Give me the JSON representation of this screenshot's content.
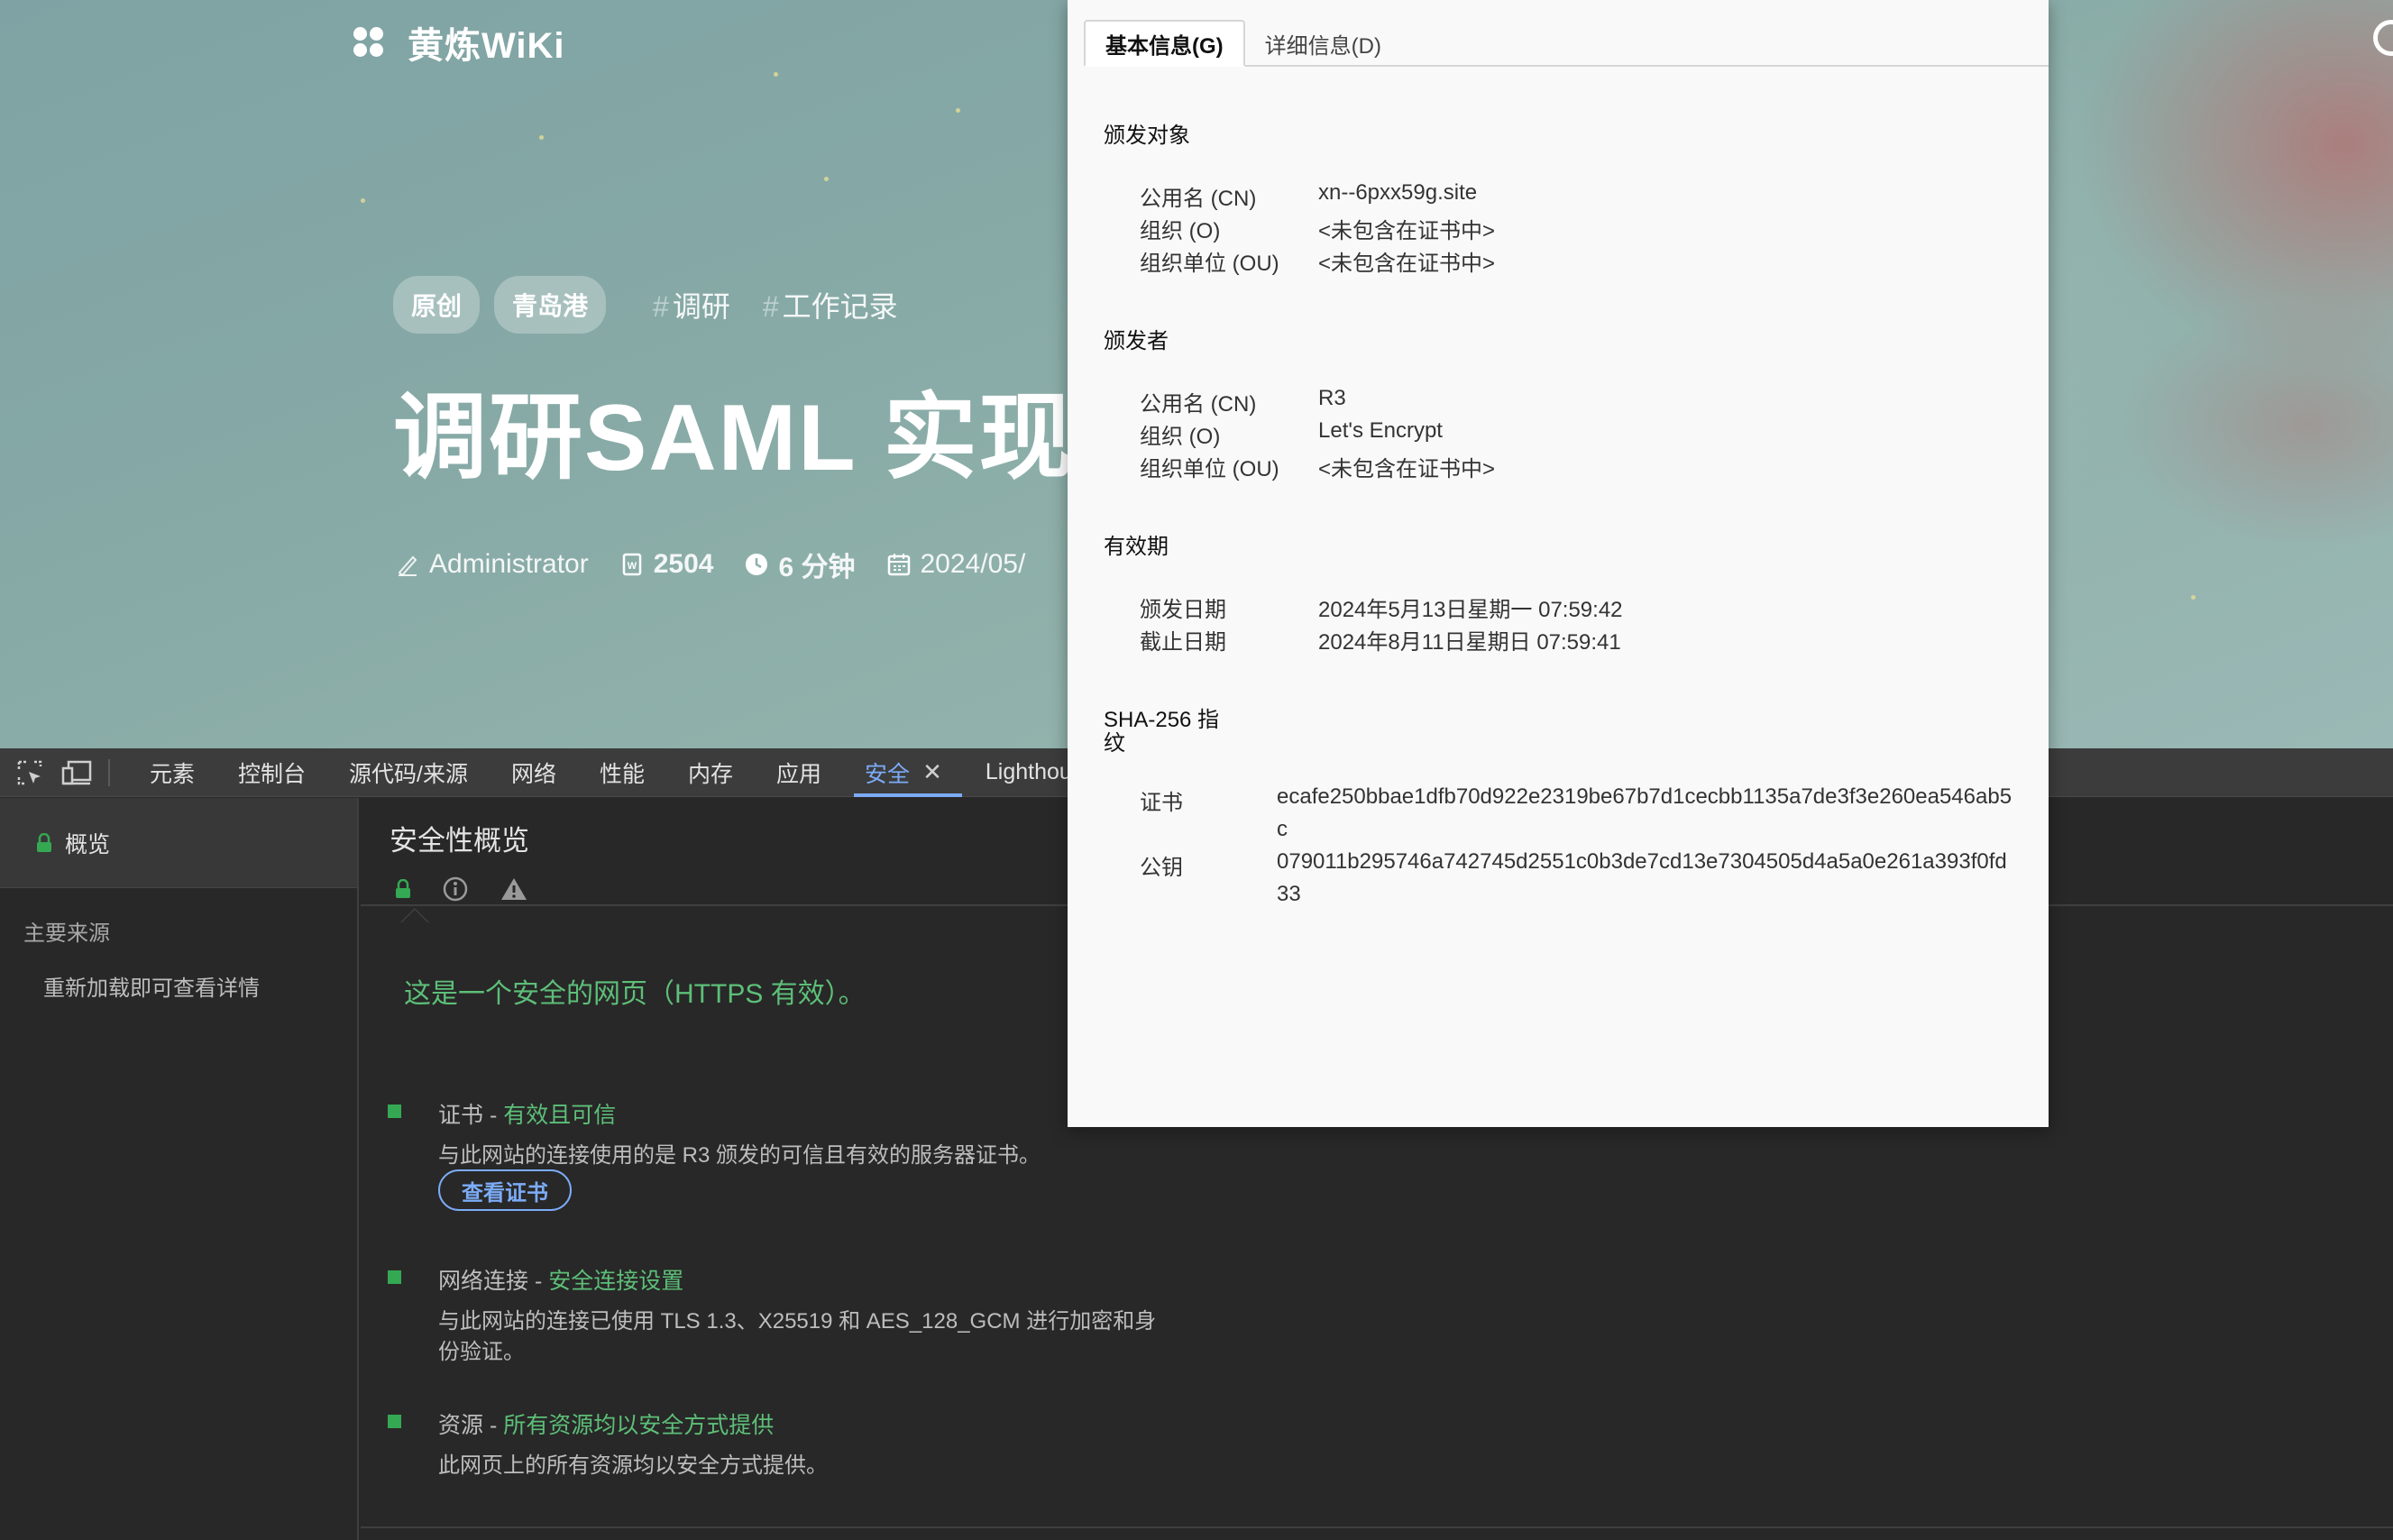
{
  "site": {
    "logo_title": "黄炼WiKi",
    "tags": [
      "原创",
      "青岛港"
    ],
    "hashtags": [
      "调研",
      "工作记录"
    ],
    "post_title": "调研SAML 实现",
    "meta": {
      "author": "Administrator",
      "word_count": "2504",
      "read_time": "6 分钟",
      "date": "2024/05/"
    }
  },
  "devtools": {
    "tabs": [
      {
        "label": "元素"
      },
      {
        "label": "控制台"
      },
      {
        "label": "源代码/来源"
      },
      {
        "label": "网络"
      },
      {
        "label": "性能"
      },
      {
        "label": "内存"
      },
      {
        "label": "应用"
      },
      {
        "label": "安全",
        "active": true
      },
      {
        "label": "Lighthouse"
      }
    ],
    "sidebar": {
      "overview": "概览",
      "main_origin_heading": "主要来源",
      "reload_hint": "重新加载即可查看详情"
    },
    "main": {
      "title": "安全性概览",
      "summary": "这是一个安全的网页（HTTPS 有效）。",
      "items": [
        {
          "label": "证书 - ",
          "status": "有效且可信",
          "desc": "与此网站的连接使用的是 R3 颁发的可信且有效的服务器证书。",
          "button": "查看证书"
        },
        {
          "label": "网络连接 - ",
          "status": "安全连接设置",
          "desc": "与此网站的连接已使用 TLS 1.3、X25519 和 AES_128_GCM 进行加密和身份验证。"
        },
        {
          "label": "资源 - ",
          "status": "所有资源均以安全方式提供",
          "desc": "此网页上的所有资源均以安全方式提供。"
        }
      ]
    }
  },
  "certificate": {
    "tabs": [
      "基本信息(G)",
      "详细信息(D)"
    ],
    "issued_to": {
      "title": "颁发对象",
      "rows": [
        {
          "key": "公用名 (CN)",
          "value": "xn--6pxx59g.site"
        },
        {
          "key": "组织 (O)",
          "value": "<未包含在证书中>"
        },
        {
          "key": "组织单位 (OU)",
          "value": "<未包含在证书中>"
        }
      ]
    },
    "issued_by": {
      "title": "颁发者",
      "rows": [
        {
          "key": "公用名 (CN)",
          "value": "R3"
        },
        {
          "key": "组织 (O)",
          "value": "Let's Encrypt"
        },
        {
          "key": "组织单位 (OU)",
          "value": "<未包含在证书中>"
        }
      ]
    },
    "validity": {
      "title": "有效期",
      "rows": [
        {
          "key": "颁发日期",
          "value": "2024年5月13日星期一 07:59:42"
        },
        {
          "key": "截止日期",
          "value": "2024年8月11日星期日 07:59:41"
        }
      ]
    },
    "fingerprints": {
      "title_line1": "SHA-256 指",
      "title_line2": "纹",
      "rows": [
        {
          "key": "证书",
          "value": "ecafe250bbae1dfb70d922e2319be67b7d1cecbb1135a7de3f3e260ea546ab5c"
        },
        {
          "key": "公钥",
          "value": "079011b295746a742745d2551c0b3de7cd13e7304505d4a5a0e261a393f0fd33"
        }
      ]
    }
  }
}
